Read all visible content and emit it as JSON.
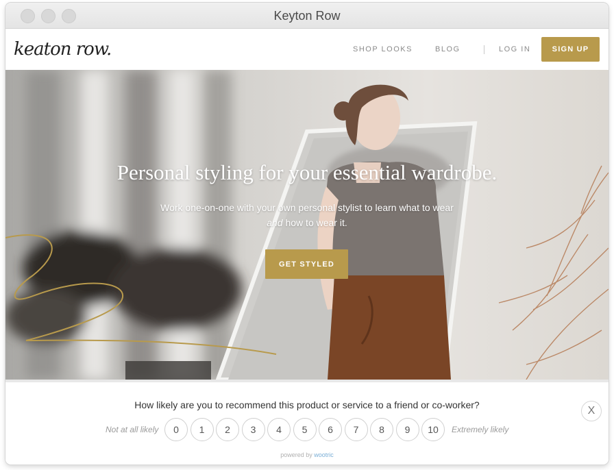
{
  "window": {
    "title": "Keyton Row"
  },
  "nav": {
    "logo": "keaton row.",
    "shop_looks": "SHOP LOOKS",
    "blog": "BLOG",
    "login": "LOG IN",
    "signup": "SIGN UP"
  },
  "hero": {
    "title": "Personal styling for your essential wardrobe.",
    "subtitle_part1": "Work one-on-one with your own personal stylist to learn what to wear ",
    "subtitle_em": "and",
    "subtitle_part2": " how to wear it.",
    "cta": "GET STYLED"
  },
  "survey": {
    "question": "How likely are you to recommend this product or service to a friend or co-worker?",
    "low_label": "Not at all likely",
    "high_label": "Extremely likely",
    "scores": [
      "0",
      "1",
      "2",
      "3",
      "4",
      "5",
      "6",
      "7",
      "8",
      "9",
      "10"
    ],
    "close": "X",
    "powered_prefix": "powered by ",
    "powered_brand": "wootric"
  },
  "colors": {
    "accent": "#b89a4c",
    "nav_text": "#8a8a8a",
    "wootric_blue": "#7aaed6"
  }
}
